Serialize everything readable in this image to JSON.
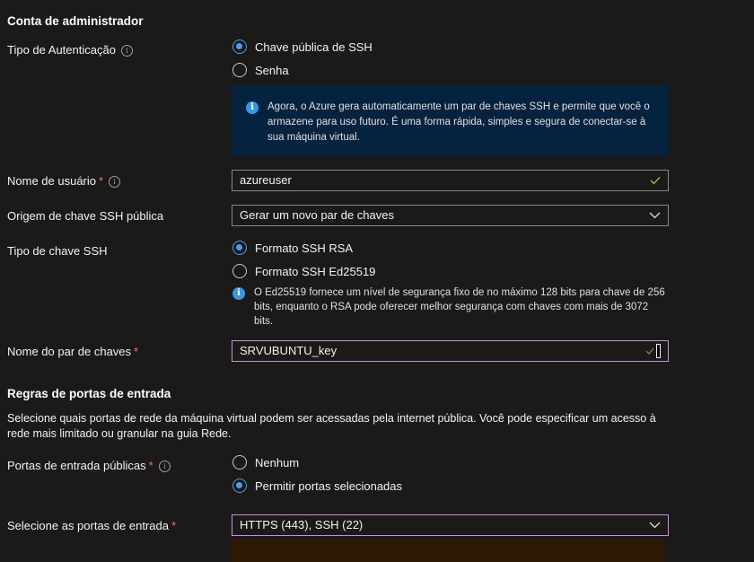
{
  "admin": {
    "title": "Conta de administrador",
    "auth_type": {
      "label": "Tipo de Autenticação",
      "options": [
        "Chave pública de SSH",
        "Senha"
      ],
      "selected": "Chave pública de SSH",
      "info": "Agora, o Azure gera automaticamente um par de chaves SSH e permite que você o armazene para uso futuro. É uma forma rápida, simples e segura de conectar-se à sua máquina virtual."
    },
    "username": {
      "label": "Nome de usuário",
      "value": "azureuser"
    },
    "key_source": {
      "label": "Origem de chave SSH pública",
      "value": "Gerar um novo par de chaves"
    },
    "key_type": {
      "label": "Tipo de chave SSH",
      "options": [
        "Formato SSH RSA",
        "Formato SSH Ed25519"
      ],
      "selected": "Formato SSH RSA",
      "info": "O Ed25519 fornece um nível de segurança fixo de no máximo 128 bits para chave de 256 bits, enquanto o RSA pode oferecer melhor segurança com chaves com mais de 3072 bits."
    },
    "key_pair_name": {
      "label": "Nome do par de chaves",
      "value": "SRVUBUNTU_key"
    }
  },
  "inbound": {
    "title": "Regras de portas de entrada",
    "description": "Selecione quais portas de rede da máquina virtual podem ser acessadas pela internet pública. Você pode especificar um acesso à rede mais limitado ou granular na guia Rede.",
    "public_ports": {
      "label": "Portas de entrada públicas",
      "options": [
        "Nenhum",
        "Permitir portas selecionadas"
      ],
      "selected": "Permitir portas selecionadas"
    },
    "select_ports": {
      "label": "Selecione as portas de entrada",
      "value": "HTTPS (443), SSH (22)"
    }
  },
  "required_marker": "*",
  "colors": {
    "background": "#1b1a19",
    "accent": "#4f9dec",
    "info_box": "#05233f",
    "focus_border": "#c78ee5",
    "required": "#f1707b",
    "valid_check": "#92c353"
  }
}
